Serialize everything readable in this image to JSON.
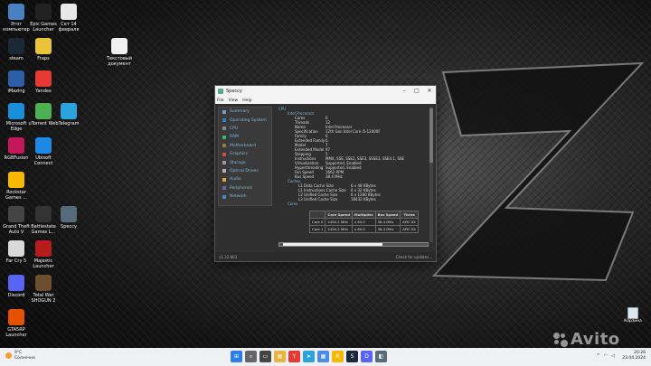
{
  "desktop": {
    "icons": [
      {
        "label": "Этот компьютер",
        "icon": "computer-icon",
        "color": "#4a7fc1"
      },
      {
        "label": "Epic Games Launcher",
        "icon": "epic-games-icon",
        "color": "#222222"
      },
      {
        "label": "Сет 14 февраля",
        "icon": "document-icon",
        "color": "#e8e8e8"
      },
      {
        "label": "Текстовый документ",
        "icon": "text-document-icon",
        "color": "#f0f0f0"
      },
      {
        "label": "steam",
        "icon": "steam-icon",
        "color": "#1b2838"
      },
      {
        "label": "Fraps",
        "icon": "fraps-icon",
        "color": "#e9c43a"
      },
      {
        "label": "iMazing",
        "icon": "imazing-icon",
        "color": "#2c5ea8"
      },
      {
        "label": "Yandex",
        "icon": "yandex-icon",
        "color": "#e53935"
      },
      {
        "label": "Microsoft Edge",
        "icon": "edge-icon",
        "color": "#1a8fd9"
      },
      {
        "label": "uTorrent Web",
        "icon": "utorrent-icon",
        "color": "#4caf50"
      },
      {
        "label": "Telegram",
        "icon": "telegram-icon",
        "color": "#2aa3de"
      },
      {
        "label": "RGBFusion",
        "icon": "rgbfusion-icon",
        "color": "#c2185b"
      },
      {
        "label": "Ubisoft Connect",
        "icon": "ubisoft-icon",
        "color": "#1e88e5"
      },
      {
        "label": "Rockstar Games ...",
        "icon": "rockstar-icon",
        "color": "#f6b800"
      },
      {
        "label": "Grand Theft Auto V",
        "icon": "gta-icon",
        "color": "#444444"
      },
      {
        "label": "Battlestate Games L...",
        "icon": "battlestate-icon",
        "color": "#333333"
      },
      {
        "label": "Speccy",
        "icon": "speccy-icon",
        "color": "#556b7a"
      },
      {
        "label": "Far Cry 5",
        "icon": "farcry-icon",
        "color": "#d9d9d9"
      },
      {
        "label": "Majestic Launcher",
        "icon": "majestic-icon",
        "color": "#b71c1c"
      },
      {
        "label": "Discord",
        "icon": "discord-icon",
        "color": "#5865f2"
      },
      {
        "label": "Total War SHOGUN 2",
        "icon": "shogun-icon",
        "color": "#6d4c2f"
      },
      {
        "label": "GTA5RP Launcher",
        "icon": "gta5rp-icon",
        "color": "#e65100"
      }
    ],
    "recycle_bin": "Корзина",
    "watermark": "Avito"
  },
  "window": {
    "title": "Speccy",
    "menu": [
      "File",
      "View",
      "Help"
    ],
    "sidebar": [
      {
        "label": "Summary",
        "color": "#7a9bc0"
      },
      {
        "label": "Operating System",
        "color": "#2f7dd1"
      },
      {
        "label": "CPU",
        "color": "#7e8a96"
      },
      {
        "label": "RAM",
        "color": "#3cb371"
      },
      {
        "label": "Motherboard",
        "color": "#9a7a3a"
      },
      {
        "label": "Graphics",
        "color": "#d04a4a"
      },
      {
        "label": "Storage",
        "color": "#999999"
      },
      {
        "label": "Optical Drives",
        "color": "#b0b0b0"
      },
      {
        "label": "Audio",
        "color": "#e0a040"
      },
      {
        "label": "Peripherals",
        "color": "#6a6a9a"
      },
      {
        "label": "Network",
        "color": "#4a8ac8"
      }
    ],
    "content": {
      "section": "CPU",
      "processor": "Intel Processor",
      "rows": [
        {
          "k": "Cores",
          "v": "6"
        },
        {
          "k": "Threads",
          "v": "12"
        },
        {
          "k": "Name",
          "v": "Intel Processor"
        },
        {
          "k": "Specification",
          "v": "12th Gen Intel Core i5-12400F"
        },
        {
          "k": "Family",
          "v": "6"
        },
        {
          "k": "Extended Family",
          "v": "6"
        },
        {
          "k": "Model",
          "v": "7"
        },
        {
          "k": "Extended Model",
          "v": "97"
        },
        {
          "k": "Stepping",
          "v": "5"
        },
        {
          "k": "Instructions",
          "v": "MMX, SSE, SSE2, SSE3, SSSE3, SSE4.1, SSE"
        },
        {
          "k": "Virtualization",
          "v": "Supported, Enabled"
        },
        {
          "k": "Hyperthreading",
          "v": "Supported, Enabled"
        },
        {
          "k": "Fan Speed",
          "v": "1662 RPM"
        },
        {
          "k": "Bus Speed",
          "v": "38.4 MHz"
        }
      ],
      "caches_label": "Caches",
      "caches": [
        {
          "k": "L1 Data Cache Size",
          "v": "6 x 48 KBytes"
        },
        {
          "k": "L1 Instructions Cache Size",
          "v": "6 x 32 KBytes"
        },
        {
          "k": "L2 Unified Cache Size",
          "v": "6 x 1280 KBytes"
        },
        {
          "k": "L3 Unified Cache Size",
          "v": "18432 KBytes"
        }
      ],
      "cores_label": "Cores",
      "core_table": {
        "headers": [
          "",
          "Core Speed",
          "Multiplier",
          "Bus Speed",
          "Threa"
        ],
        "rows": [
          [
            "Core 0",
            "2494.2 MHz",
            "x 65.0",
            "38.4 MHz",
            "APIC ID:"
          ],
          [
            "Core 1",
            "2494.2 MHz",
            "x 65.0",
            "38.4 MHz",
            "APIC ID:"
          ]
        ]
      }
    },
    "version": "v1.32.803",
    "check_updates": "Check for updates..."
  },
  "taskbar": {
    "weather_temp": "9°C",
    "weather_desc": "Солнечно",
    "time": "20:26",
    "date": "23.04.2024",
    "apps": [
      {
        "icon": "windows-start-icon",
        "color": "#2b7de9",
        "glyph": "⊞"
      },
      {
        "icon": "search-icon",
        "color": "#666666",
        "glyph": "⌕"
      },
      {
        "icon": "task-view-icon",
        "color": "#444444",
        "glyph": "▭"
      },
      {
        "icon": "file-explorer-icon",
        "color": "#e8b53a",
        "glyph": "▤"
      },
      {
        "icon": "yandex-browser-icon",
        "color": "#e53935",
        "glyph": "Y"
      },
      {
        "icon": "telegram-icon",
        "color": "#2aa3de",
        "glyph": "➤"
      },
      {
        "icon": "ms-store-icon",
        "color": "#4a8ae8",
        "glyph": "▦"
      },
      {
        "icon": "rockstar-icon",
        "color": "#f6b800",
        "glyph": "R"
      },
      {
        "icon": "steam-icon",
        "color": "#1b2838",
        "glyph": "S"
      },
      {
        "icon": "discord-icon",
        "color": "#5865f2",
        "glyph": "D"
      },
      {
        "icon": "speccy-icon",
        "color": "#556b7a",
        "glyph": "◧"
      }
    ]
  }
}
